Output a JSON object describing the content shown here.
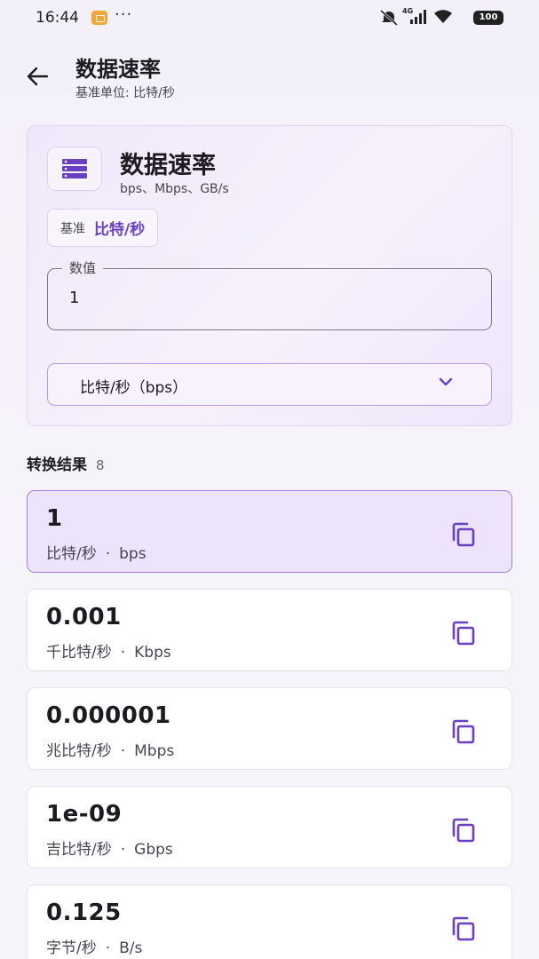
{
  "status_bar": {
    "time": "16:44",
    "dots": "···",
    "network": "4G",
    "battery": "100"
  },
  "app_bar": {
    "title": "数据速率",
    "subtitle": "基准单位: 比特/秒"
  },
  "category": {
    "icon": "storage-icon",
    "title": "数据速率",
    "examples": "bps、Mbps、GB/s"
  },
  "base": {
    "label": "基准",
    "value": "比特/秒"
  },
  "value_field": {
    "label": "数值",
    "value": "1"
  },
  "unit_select": {
    "value": "比特/秒（bps）"
  },
  "results": {
    "title": "转换结果",
    "count": "8",
    "separator": "·",
    "items": [
      {
        "value": "1",
        "unit_name": "比特/秒",
        "unit_symbol": "bps",
        "selected": true
      },
      {
        "value": "0.001",
        "unit_name": "千比特/秒",
        "unit_symbol": "Kbps",
        "selected": false
      },
      {
        "value": "0.000001",
        "unit_name": "兆比特/秒",
        "unit_symbol": "Mbps",
        "selected": false
      },
      {
        "value": "1e-09",
        "unit_name": "吉比特/秒",
        "unit_symbol": "Gbps",
        "selected": false
      },
      {
        "value": "0.125",
        "unit_name": "字节/秒",
        "unit_symbol": "B/s",
        "selected": false
      }
    ]
  },
  "colors": {
    "accent": "#6a3fc4",
    "selected_bg": "#ede3fb",
    "selected_border": "#a47fe0",
    "background": "#f4f0fa"
  }
}
